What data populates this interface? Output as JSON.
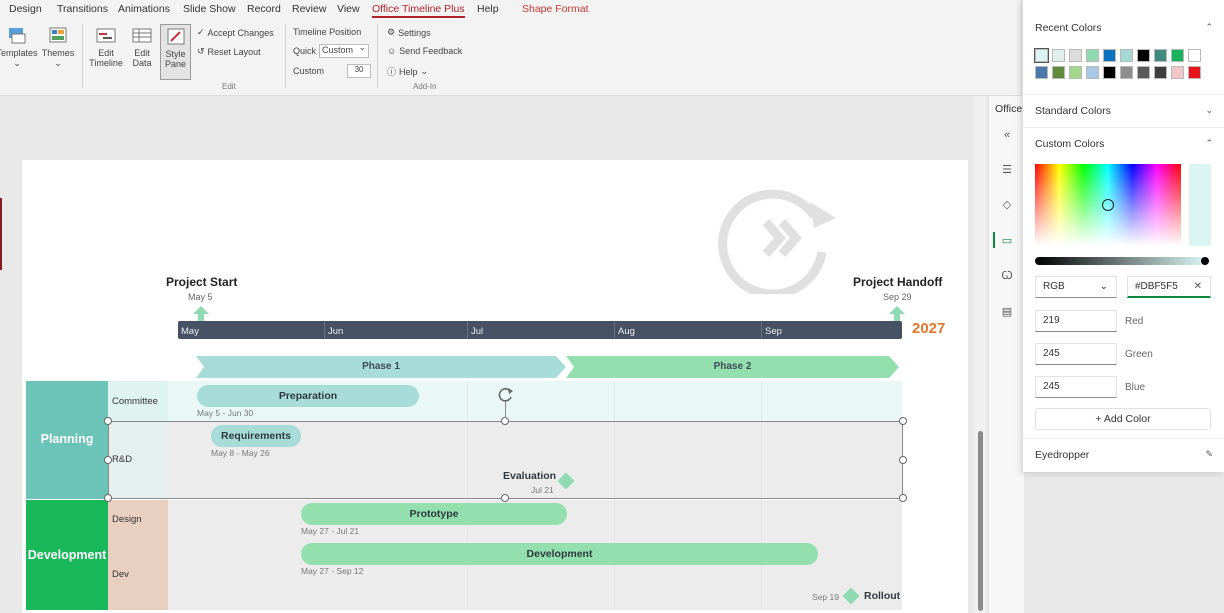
{
  "menu_tabs": [
    "Design",
    "Transitions",
    "Animations",
    "Slide Show",
    "Record",
    "Review",
    "View",
    "Office Timeline Plus",
    "Help",
    "Shape Format"
  ],
  "ribbon": {
    "templates": "Templates",
    "themes": "Themes",
    "edit_timeline": [
      "Edit",
      "Timeline"
    ],
    "edit_data": [
      "Edit",
      "Data"
    ],
    "style_pane": [
      "Style",
      "Pane"
    ],
    "accept_changes": "Accept Changes",
    "reset_layout": "Reset Layout",
    "group_edit": "Edit",
    "timeline_position": "Timeline Position",
    "quick": "Quick",
    "quick_value": "Custom",
    "custom": "Custom",
    "custom_value": "30",
    "settings": "Settings",
    "send_feedback": "Send Feedback",
    "help": "Help",
    "group_addin": "Add-In"
  },
  "timeline": {
    "start_title": "Project Start",
    "start_date": "May 5",
    "end_title": "Project Handoff",
    "end_date": "Sep 29",
    "year": "2027",
    "months": [
      "May",
      "Jun",
      "Jul",
      "Aug",
      "Sep"
    ],
    "phases": [
      "Phase 1",
      "Phase 2"
    ],
    "groups": [
      "Planning",
      "Development"
    ],
    "swimlanes": [
      "Committee",
      "R&D",
      "Design",
      "Dev"
    ],
    "tasks": [
      {
        "name": "Preparation",
        "dates": "May 5 - Jun 30"
      },
      {
        "name": "Requirements",
        "dates": "May 8 - May 26"
      },
      {
        "name": "Prototype",
        "dates": "May 27 - Jul 21"
      },
      {
        "name": "Development",
        "dates": "May 27 - Sep 12"
      }
    ],
    "evaluation": {
      "name": "Evaluation",
      "date": "Jul 21"
    },
    "rollout": {
      "name": "Rollout",
      "date": "Sep 19"
    }
  },
  "side_pane": {
    "title": "Office"
  },
  "color_picker": {
    "recent_colors": "Recent Colors",
    "standard_colors": "Standard Colors",
    "custom_colors": "Custom Colors",
    "model": "RGB",
    "hex": "#DBF5F5",
    "red": "219",
    "green": "245",
    "blue": "245",
    "red_label": "Red",
    "green_label": "Green",
    "blue_label": "Blue",
    "add_color": "Add Color",
    "eyedropper": "Eyedropper",
    "recent_swatches": [
      "#dbf5f5",
      "#e0f0ec",
      "#dcdcdc",
      "#8fdab0",
      "#0c72c0",
      "#a6dad6",
      "#000000",
      "#3f8a7f",
      "#19b35f",
      "#ffffff",
      "#4a78a8",
      "#5e8c3a",
      "#a4d68b",
      "#a9c8e8",
      "#000000",
      "#8d8d8d",
      "#595959",
      "#3d3d3d",
      "#f0c8c8",
      "#e8141b"
    ]
  },
  "colors": {
    "accent": "#b4232a",
    "timeline_bar": "#465264",
    "planning": "#6cc4b8",
    "development": "#19b85a",
    "phase1": "#a8dcd9",
    "phase2": "#93dfae",
    "year": "#e2782a"
  }
}
